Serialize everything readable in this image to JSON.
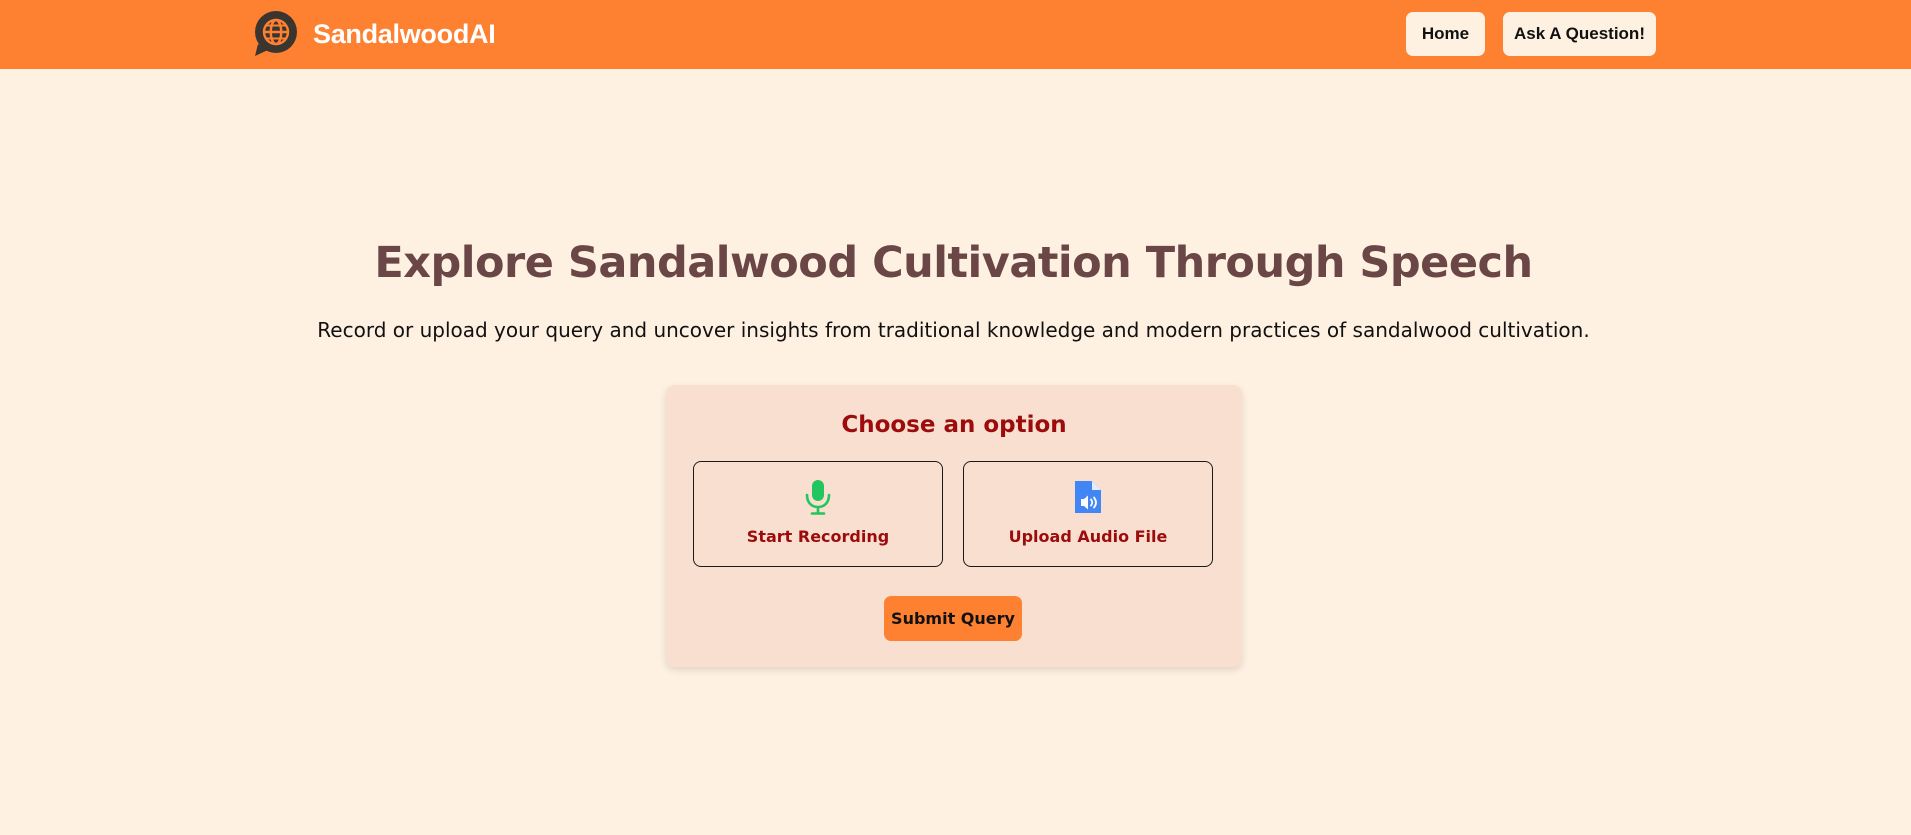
{
  "navbar": {
    "brand_name": "SandalwoodAI",
    "brand_icon": "globe-chat-icon",
    "home_label": "Home",
    "ask_label": "Ask A Question!"
  },
  "hero": {
    "title": "Explore Sandalwood Cultivation Through Speech",
    "subtitle": "Record or upload your query and uncover insights from traditional knowledge and modern practices of sandalwood cultivation."
  },
  "card": {
    "title": "Choose an option",
    "options": [
      {
        "label": "Start Recording",
        "icon": "microphone-icon"
      },
      {
        "label": "Upload Audio File",
        "icon": "audio-file-icon"
      }
    ],
    "submit_label": "Submit Query"
  },
  "colors": {
    "navbar": "#fe8131",
    "page_background": "#fef1e2",
    "card_background": "#f9dfd0",
    "title_text": "#6a4646",
    "accent_red": "#9c0c0c",
    "microphone_green": "#22c55e",
    "file_blue": "#4285f4"
  }
}
